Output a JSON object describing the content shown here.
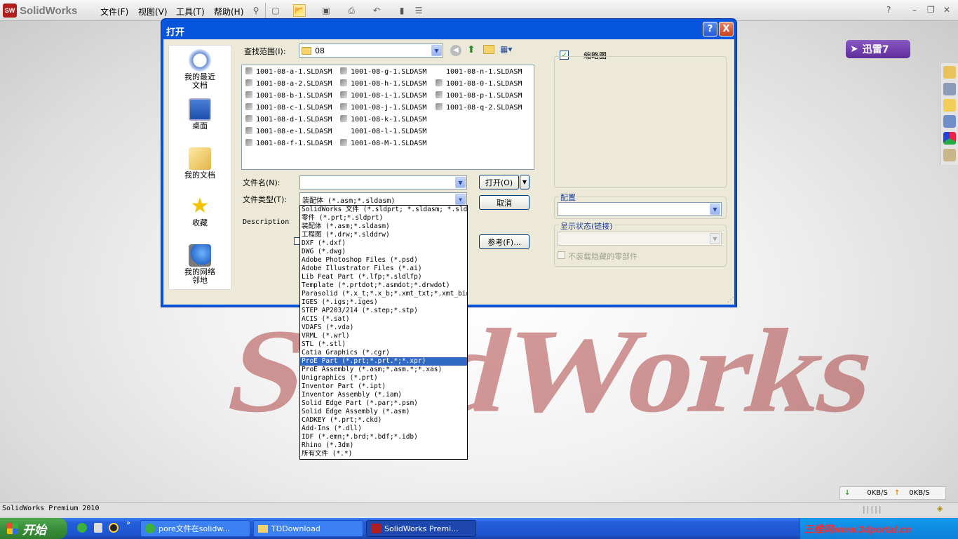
{
  "app": {
    "logo": "SolidWorks",
    "menus": [
      "文件(F)",
      "视图(V)",
      "工具(T)",
      "帮助(H)"
    ],
    "help": "?"
  },
  "background": {
    "watermark": "SolidWorks"
  },
  "xunlei": {
    "label": "迅雷7"
  },
  "dialog": {
    "title": "打开",
    "help_btn": "?",
    "close_btn": "X",
    "places": [
      "我的最近文档",
      "桌面",
      "我的文档",
      "收藏",
      "我的网络邻地"
    ],
    "lookin_label": "查找范围(I):",
    "lookin_value": "08",
    "files_col1": [
      "1001-08-a-1.SLDASM",
      "1001-08-a-2.SLDASM",
      "1001-08-b-1.SLDASM",
      "1001-08-c-1.SLDASM",
      "1001-08-d-1.SLDASM",
      "1001-08-e-1.SLDASM",
      "1001-08-f-1.SLDASM"
    ],
    "files_col2": [
      "1001-08-g-1.SLDASM",
      "1001-08-h-1.SLDASM",
      "1001-08-i-1.SLDASM",
      "1001-08-j-1.SLDASM",
      "1001-08-k-1.SLDASM",
      "1001-08-l-1.SLDASM",
      "1001-08-M-1.SLDASM"
    ],
    "files_col3": [
      "1001-08-n-1.SLDASM",
      "1001-08-0-1.SLDASM",
      "1001-08-p-1.SLDASM",
      "1001-08-q-2.SLDASM"
    ],
    "filename_label": "文件名(N):",
    "filename_value": "",
    "filetype_label": "文件类型(T):",
    "filetype_value": "装配体 (*.asm;*.sldasm)",
    "description_label": "Description",
    "open_btn": "打开(O)",
    "cancel_btn": "取消",
    "refs_btn": "参考(F)...",
    "thumbnail_label": "缩略图",
    "thumbnail_checked": true,
    "config_label": "配置",
    "display_state_label": "显示状态(链接)",
    "hide_parts_label": "不装载隐藏的零部件",
    "file_types": [
      "SolidWorks 文件 (*.sldprt; *.sldasm; *.slddrw)",
      "零件 (*.prt;*.sldprt)",
      "装配体 (*.asm;*.sldasm)",
      "工程图 (*.drw;*.slddrw)",
      "DXF (*.dxf)",
      "DWG (*.dwg)",
      "Adobe Photoshop Files (*.psd)",
      "Adobe Illustrator Files (*.ai)",
      "Lib Feat Part (*.lfp;*.sldlfp)",
      "Template (*.prtdot;*.asmdot;*.drwdot)",
      "Parasolid (*.x_t;*.x_b;*.xmt_txt;*.xmt_bin)",
      "IGES (*.igs;*.iges)",
      "STEP AP203/214 (*.step;*.stp)",
      "ACIS (*.sat)",
      "VDAFS (*.vda)",
      "VRML (*.wrl)",
      "STL (*.stl)",
      "Catia Graphics (*.cgr)",
      "ProE Part (*.prt;*.prt.*;*.xpr)",
      "ProE Assembly (*.asm;*.asm.*;*.xas)",
      "Unigraphics (*.prt)",
      "Inventor Part (*.ipt)",
      "Inventor Assembly (*.iam)",
      "Solid Edge Part (*.par;*.psm)",
      "Solid Edge Assembly (*.asm)",
      "CADKEY (*.prt;*.ckd)",
      "Add-Ins (*.dll)",
      "IDF (*.emn;*.brd;*.bdf;*.idb)",
      "Rhino (*.3dm)",
      "所有文件 (*.*)"
    ],
    "selected_type_index": 18
  },
  "speed": {
    "down": "0KB/S",
    "up": "0KB/S"
  },
  "status": {
    "text": "SolidWorks Premium 2010"
  },
  "taskbar": {
    "start": "开始",
    "tasks": [
      "pore文件在solidw...",
      "TDDownload",
      "SolidWorks Premi..."
    ],
    "site": "三维网www.3dportal.cn"
  },
  "colors": {
    "accent": "#0855dd",
    "selection": "#316ac5",
    "taskbar": "#245edb",
    "start": "#3a8e3a"
  }
}
